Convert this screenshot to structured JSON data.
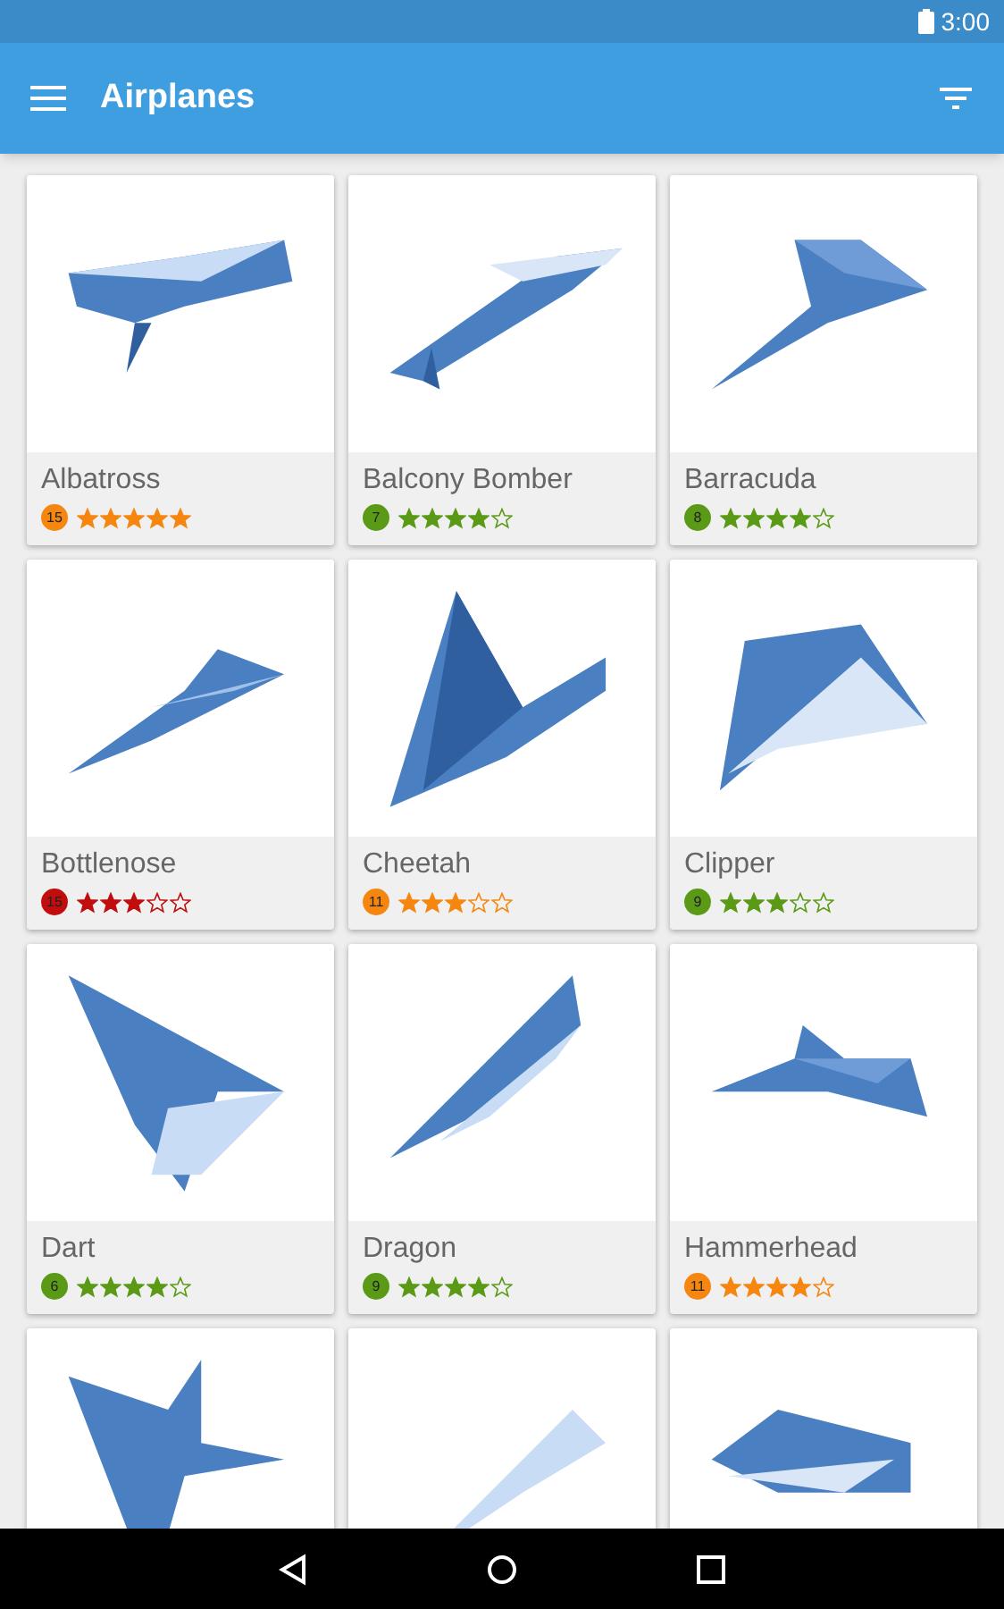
{
  "status_bar": {
    "time": "3:00"
  },
  "app_bar": {
    "title": "Airplanes"
  },
  "airplanes": [
    {
      "name": "Albatross",
      "badge": "15",
      "color": "#f5860f",
      "stars": 5
    },
    {
      "name": "Balcony Bomber",
      "badge": "7",
      "color": "#5a9a16",
      "stars": 4
    },
    {
      "name": "Barracuda",
      "badge": "8",
      "color": "#5a9a16",
      "stars": 4
    },
    {
      "name": "Bottlenose",
      "badge": "15",
      "color": "#c10d0d",
      "stars": 3
    },
    {
      "name": "Cheetah",
      "badge": "11",
      "color": "#f5860f",
      "stars": 3
    },
    {
      "name": "Clipper",
      "badge": "9",
      "color": "#5a9a16",
      "stars": 3
    },
    {
      "name": "Dart",
      "badge": "6",
      "color": "#5a9a16",
      "stars": 4
    },
    {
      "name": "Dragon",
      "badge": "9",
      "color": "#5a9a16",
      "stars": 4
    },
    {
      "name": "Hammerhead",
      "badge": "11",
      "color": "#f5860f",
      "stars": 4
    }
  ],
  "partial_cards": [
    {
      "kind": "image-only"
    },
    {
      "kind": "image-only"
    },
    {
      "kind": "image-only"
    }
  ]
}
